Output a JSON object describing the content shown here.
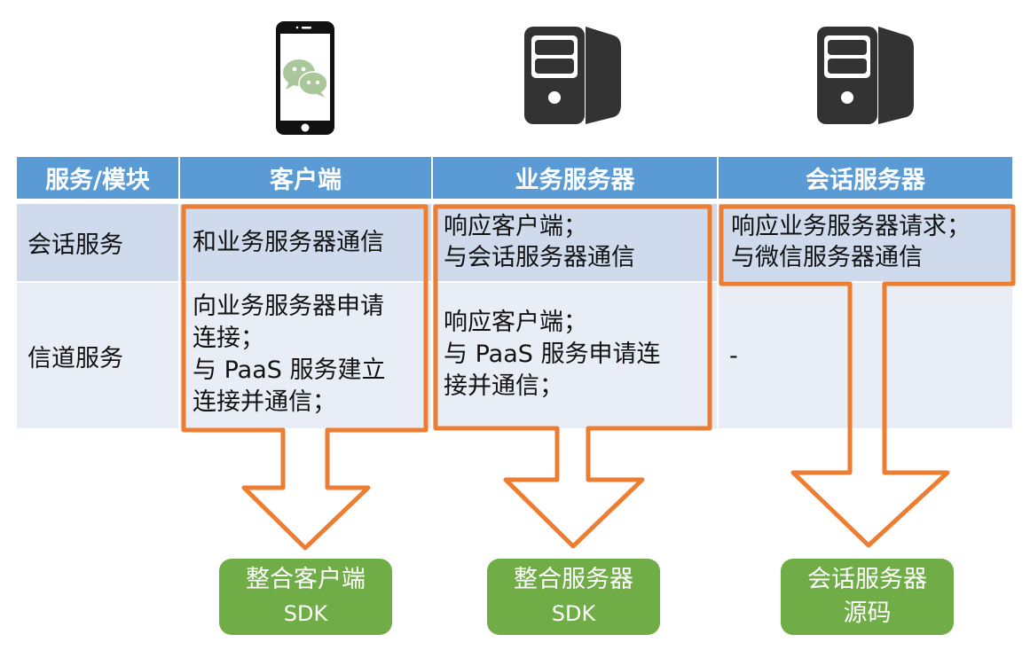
{
  "icons": [
    {
      "name": "mobile-client-icon",
      "label": "client phone with chat app"
    },
    {
      "name": "business-server-icon",
      "label": "business server"
    },
    {
      "name": "session-server-icon",
      "label": "session server"
    }
  ],
  "table": {
    "headers": [
      "服务/模块",
      "客户端",
      "业务服务器",
      "会话服务器"
    ],
    "rows": [
      {
        "label": "会话服务",
        "cells": [
          "和业务服务器通信",
          "响应客户端；\n与会话服务器通信",
          "响应业务服务器请求；\n与微信服务器通信"
        ]
      },
      {
        "label": "信道服务",
        "cells": [
          "向业务服务器申请\n连接；\n与 PaaS 服务建立\n连接并通信；",
          "响应客户端；\n与 PaaS 服务申请连\n接并通信；",
          "-"
        ]
      }
    ]
  },
  "outcomes": [
    {
      "line1": "整合客户端",
      "line2": "SDK"
    },
    {
      "line1": "整合服务器",
      "line2": "SDK"
    },
    {
      "line1": "会话服务器",
      "line2": "源码"
    }
  ],
  "colors": {
    "header_bg": "#5B9BD5",
    "row1_bg": "#CFDBEC",
    "row2_bg": "#E9EDF5",
    "highlight_orange": "#ED7D31",
    "outcome_green": "#70AD47",
    "icon_dark": "#333333",
    "wechat_green": "#A9C79A"
  }
}
